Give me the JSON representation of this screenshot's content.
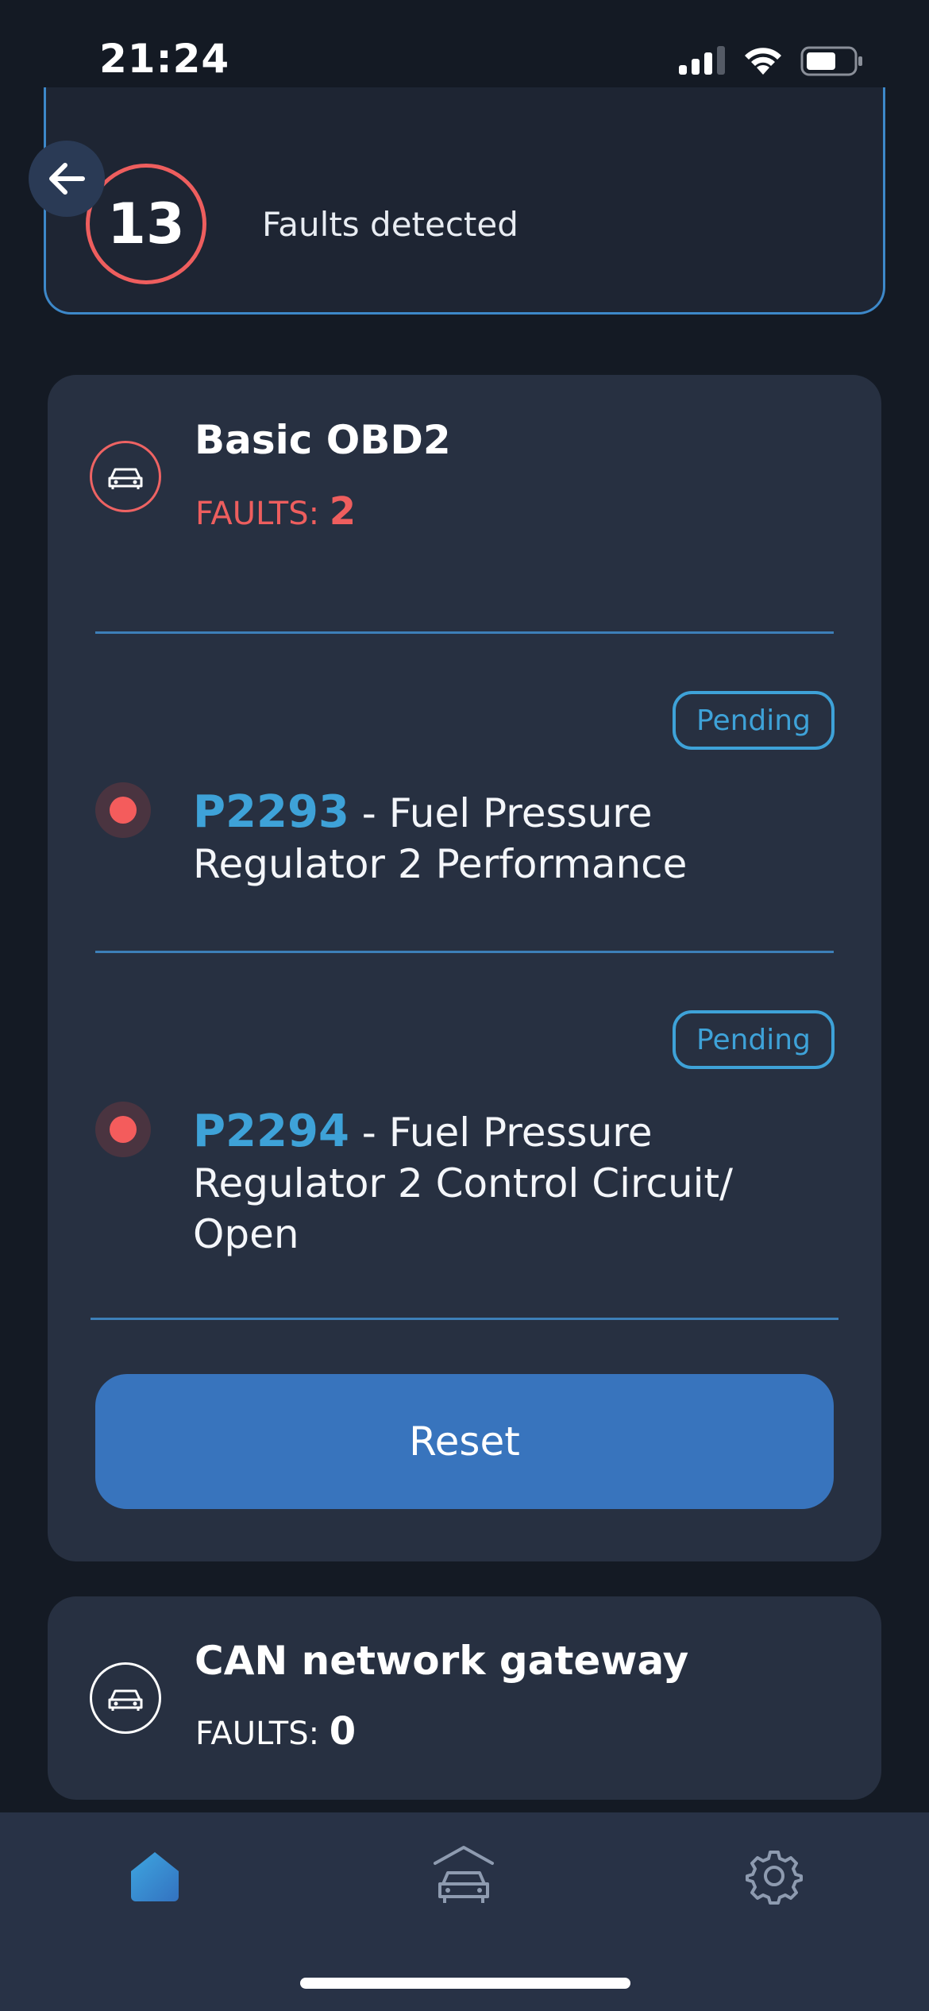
{
  "status_bar": {
    "time": "21:24"
  },
  "summary": {
    "count": "13",
    "label": "Faults detected"
  },
  "modules": [
    {
      "title": "Basic OBD2",
      "faults_label": "FAULTS: ",
      "faults_count": "2",
      "faults": [
        {
          "status": "Pending",
          "code": "P2293",
          "description": " - Fuel Pressure Regulator 2 Performance"
        },
        {
          "status": "Pending",
          "code": "P2294",
          "description": " - Fuel Pressure Regulator 2 Control Circuit/ Open"
        }
      ],
      "reset_label": "Reset"
    },
    {
      "title": "CAN network gateway",
      "faults_label": "FAULTS: ",
      "faults_count": "0"
    }
  ],
  "colors": {
    "background": "#141a24",
    "card": "#273041",
    "accent_blue": "#3ea2d8",
    "fault_red": "#f45c5c",
    "button_blue": "#3874bd"
  },
  "icons": [
    "back-arrow-icon",
    "car-icon",
    "home-icon",
    "garage-car-icon",
    "gear-icon"
  ]
}
